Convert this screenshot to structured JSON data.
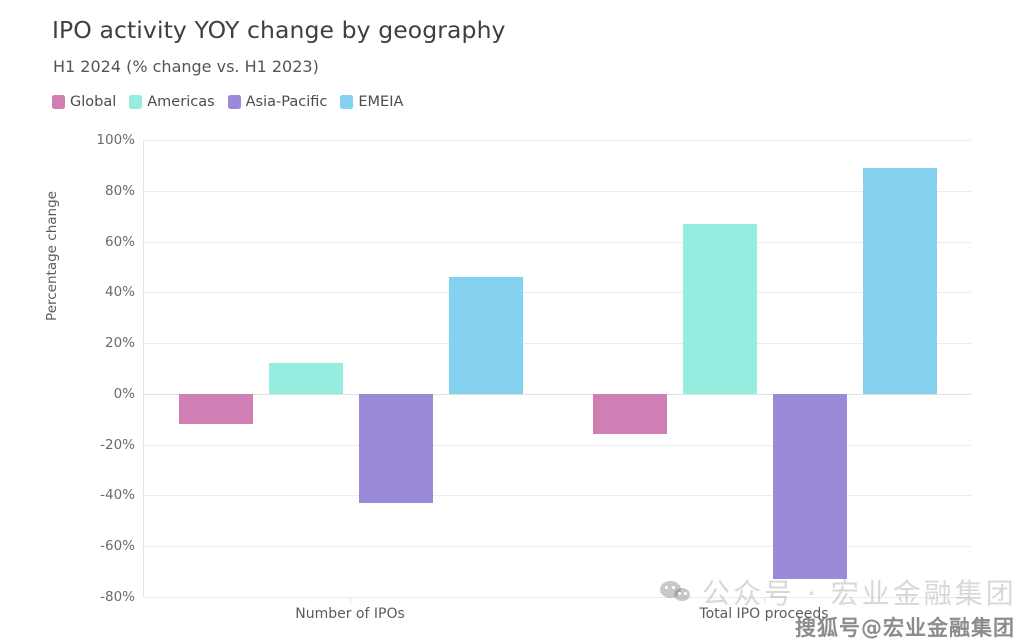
{
  "chart_data": {
    "type": "bar",
    "title": "IPO activity YOY change by geography",
    "subtitle": "H1 2024 (% change vs. H1 2023)",
    "xlabel": "",
    "ylabel": "Percentage change",
    "categories": [
      "Number of IPOs",
      "Total IPO proceeds"
    ],
    "series": [
      {
        "name": "Global",
        "color": "#cf7fb4",
        "values": [
          -12,
          -16
        ]
      },
      {
        "name": "Americas",
        "color": "#96ecdf",
        "values": [
          12,
          67
        ]
      },
      {
        "name": "Asia-Pacific",
        "color": "#9b8ad8",
        "values": [
          -43,
          -73
        ]
      },
      {
        "name": "EMEIA",
        "color": "#85d2f0",
        "values": [
          46,
          89
        ]
      }
    ],
    "ylim": [
      -80,
      100
    ],
    "ytick_values": [
      100,
      80,
      60,
      40,
      20,
      0,
      -20,
      -40,
      -60,
      -80
    ],
    "ytick_labels": [
      "100%",
      "80%",
      "60%",
      "40%",
      "20%",
      "0%",
      "-20%",
      "-40%",
      "-60%",
      "-80%"
    ],
    "grid": true,
    "legend_position": "top-left",
    "bar_style": "grouped"
  },
  "watermarks": {
    "wechat": "公众号 · 宏业金融集团",
    "sohu": "搜狐号@宏业金融集团",
    "wechat_icon_name": "wechat-logo-icon"
  }
}
